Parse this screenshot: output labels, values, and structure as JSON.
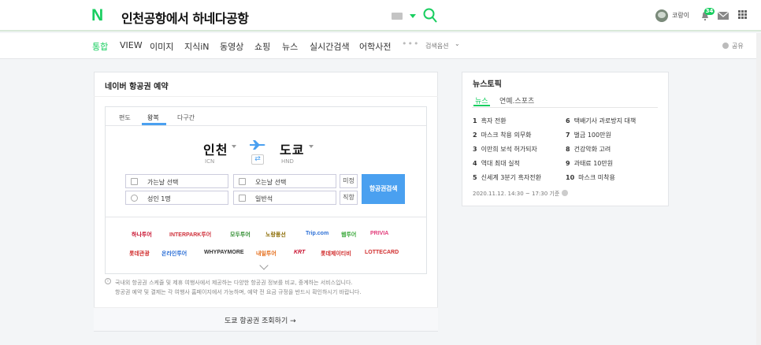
{
  "header": {
    "logo": "N",
    "query": "인천공항에서 하네다공항",
    "username": "코랑이",
    "notification_count": "34",
    "brand_color": "#19ce60"
  },
  "nav": {
    "tabs": [
      "통합",
      "VIEW",
      "이미지",
      "지식iN",
      "동영상",
      "쇼핑",
      "뉴스",
      "실시간검색",
      "어학사전"
    ],
    "more": "•••",
    "options": "검색옵션",
    "share": "공유"
  },
  "flight": {
    "title": "네이버 항공권 예약",
    "trip_tabs": [
      "편도",
      "왕복",
      "다구간"
    ],
    "from_city": "인천",
    "from_code": "ICN",
    "to_city": "도쿄",
    "to_code": "HND",
    "depart": "가는날 선택",
    "return": "오는날 선택",
    "undecided": "미정",
    "passengers": "성인 1명",
    "seat_class": "일반석",
    "direct": "직항",
    "search": "항공권검색",
    "partners": [
      "하나투어",
      "INTERPARK투어",
      "모두투어",
      "노랑풍선",
      "Trip.com",
      "웹투어",
      "PRIVIA",
      "롯데관광",
      "온라인투어",
      "WHYPAYMORE",
      "내일투어",
      "KRT",
      "롯데제이티비",
      "LOTTECARD"
    ],
    "notice_line1": "국내외 항공권 스케쥴 및 제휴 여행사에서 제공하는 다양한 항공권 정보를 비교, 중계하는 서비스입니다.",
    "notice_line2": "항공권 예약 및 결제는 각 여행사 홈페이지에서 가능하며, 예약 전 요금 규정을 반드시 확인하시기 바랍니다.",
    "footer_link": "도쿄 항공권 조회하기 →",
    "accent_color": "#4aa0f0"
  },
  "news": {
    "title": "뉴스토픽",
    "tabs": [
      "뉴스",
      "연예.스포츠"
    ],
    "left": [
      {
        "rank": "1",
        "text": "흑자 전환"
      },
      {
        "rank": "2",
        "text": "마스크 착용 의무화"
      },
      {
        "rank": "3",
        "text": "이만희 보석 허가되자"
      },
      {
        "rank": "4",
        "text": "역대 최대 실적"
      },
      {
        "rank": "5",
        "text": "신세계 3분기 흑자전환"
      }
    ],
    "right": [
      {
        "rank": "6",
        "text": "택배기사 과로방지 대책"
      },
      {
        "rank": "7",
        "text": "벌금 100만원"
      },
      {
        "rank": "8",
        "text": "건강악화 고려"
      },
      {
        "rank": "9",
        "text": "과태료 10만원"
      },
      {
        "rank": "10",
        "text": "마스크 미착용"
      }
    ],
    "timestamp": "2020.11.12. 14:30 ~ 17:30 기준"
  }
}
